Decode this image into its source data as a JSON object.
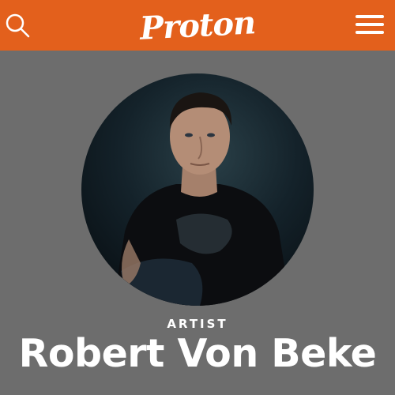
{
  "header": {
    "logo_text": "Proton",
    "search_icon": "search-icon",
    "menu_icon": "hamburger-menu-icon",
    "background_color": "#e3601c"
  },
  "profile": {
    "role": "ARTIST",
    "name": "Robert Von Beke"
  },
  "page": {
    "background_color": "#6d6d6d"
  }
}
